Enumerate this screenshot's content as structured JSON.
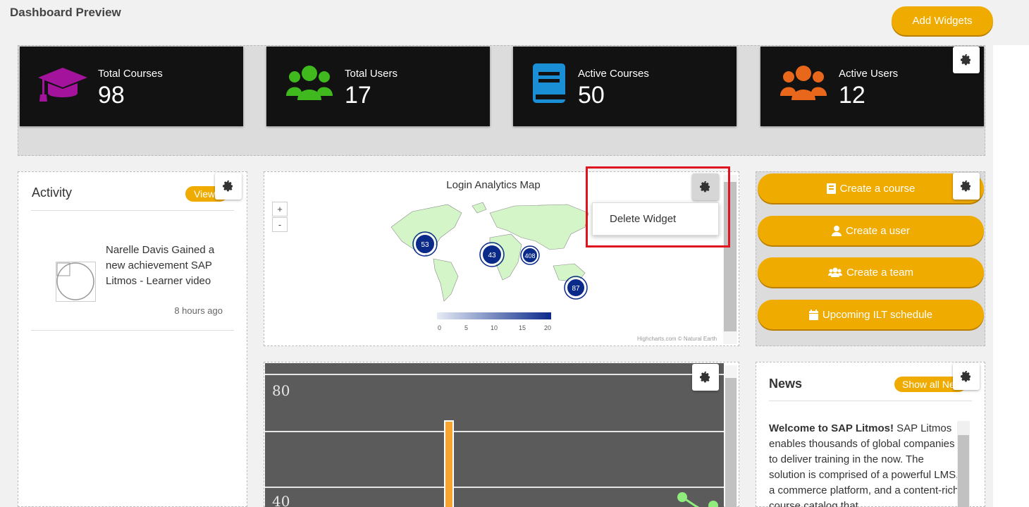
{
  "header": {
    "title": "Dashboard Preview",
    "add_widgets_label": "Add Widgets"
  },
  "stats": [
    {
      "label": "Total Courses",
      "value": "98",
      "icon": "graduation-cap-icon",
      "color": "#a4139c"
    },
    {
      "label": "Total Users",
      "value": "17",
      "icon": "users-icon",
      "color": "#3fb91d"
    },
    {
      "label": "Active Courses",
      "value": "50",
      "icon": "book-icon",
      "color": "#1a8fd6"
    },
    {
      "label": "Active Users",
      "value": "12",
      "icon": "users-icon",
      "color": "#e8671b"
    }
  ],
  "activity": {
    "title": "Activity",
    "view_label": "View",
    "items": [
      {
        "text": "Narelle Davis Gained a new achievement SAP Litmos - Learner video",
        "time": "8 hours ago"
      }
    ]
  },
  "map": {
    "title": "Login Analytics Map",
    "zoom_in": "+",
    "zoom_out": "-",
    "bubbles": [
      "53",
      "43",
      "408",
      "87"
    ],
    "legend_ticks": [
      "0",
      "5",
      "10",
      "15",
      "20"
    ],
    "credits": "Highcharts.com © Natural Earth",
    "menu": {
      "delete_label": "Delete Widget"
    }
  },
  "actions": [
    {
      "label": "Create a course",
      "icon": "book-icon"
    },
    {
      "label": "Create a user",
      "icon": "user-icon"
    },
    {
      "label": "Create a team",
      "icon": "team-icon"
    },
    {
      "label": "Upcoming ILT schedule",
      "icon": "calendar-icon"
    }
  ],
  "chart": {
    "tick_labels": [
      "80",
      "40"
    ]
  },
  "news": {
    "title": "News",
    "show_all_label": "Show all News",
    "headline": "Welcome to SAP Litmos!",
    "body": " SAP Litmos enables thousands of global companies to deliver training in the now. The solution is comprised of a powerful LMS, a commerce platform, and a content-rich course catalog that"
  },
  "colors": {
    "accent": "#f0ab00",
    "highlight": "#e0141e",
    "card_bg": "#121212"
  }
}
